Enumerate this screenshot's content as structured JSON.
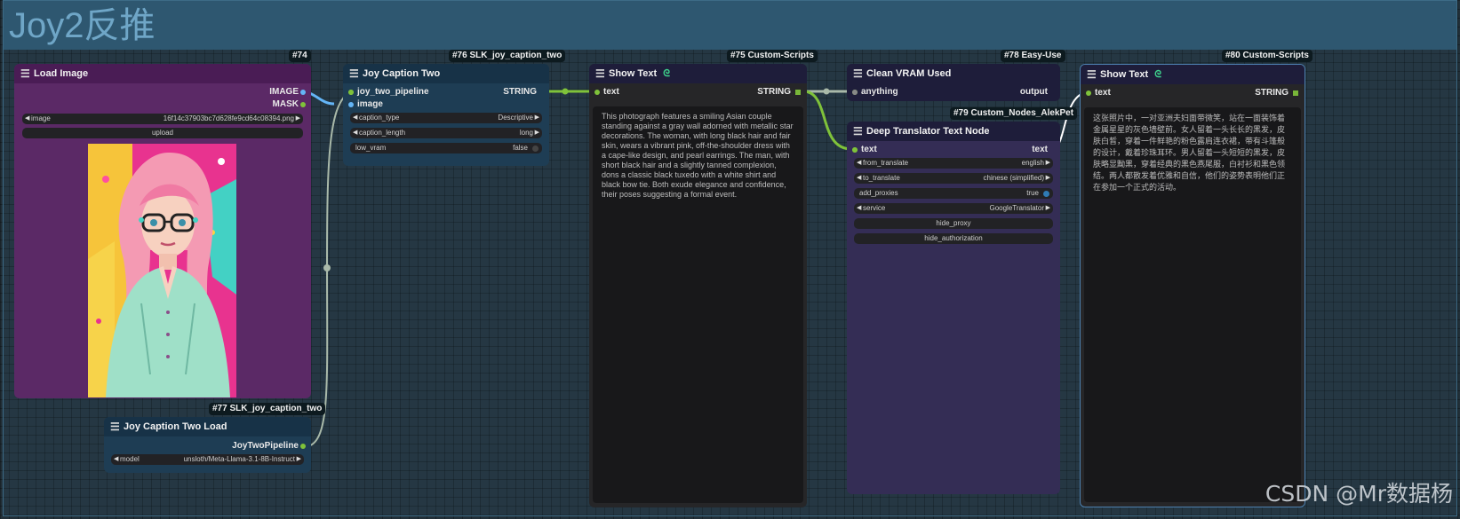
{
  "group": {
    "title": "Joy2反推"
  },
  "nodes": {
    "load_image": {
      "badge": "#74",
      "title": "Load Image",
      "outputs": [
        "IMAGE",
        "MASK"
      ],
      "image_widget": {
        "label": "image",
        "value": "16f14c37903bc7d628fe9cd64c08394.png"
      },
      "upload_label": "upload"
    },
    "caption": {
      "badge": "#76 SLK_joy_caption_two",
      "title": "Joy Caption Two",
      "inputs": [
        "joy_two_pipeline",
        "image"
      ],
      "output": "STRING",
      "widgets": [
        {
          "label": "caption_type",
          "value": "Descriptive"
        },
        {
          "label": "caption_length",
          "value": "long"
        },
        {
          "label": "low_vram",
          "value": "false"
        }
      ]
    },
    "show_text_1": {
      "badge": "#75 Custom-Scripts",
      "title": "Show Text",
      "input": "text",
      "output": "STRING",
      "text": "This photograph features a smiling Asian couple standing against a gray wall adorned with metallic star decorations. The woman, with long black hair and fair skin, wears a vibrant pink, off-the-shoulder dress with a cape-like design, and pearl earrings. The man, with short black hair and a slightly tanned complexion, dons a classic black tuxedo with a white shirt and black bow tie. Both exude elegance and confidence, their poses suggesting a formal event."
    },
    "vram": {
      "badge": "#78 Easy-Use",
      "title": "Clean VRAM Used",
      "input": "anything",
      "output": "output"
    },
    "translator": {
      "badge": "#79 Custom_Nodes_AlekPet",
      "title": "Deep Translator Text Node",
      "input": "text",
      "output": "text",
      "widgets": [
        {
          "label": "from_translate",
          "value": "english"
        },
        {
          "label": "to_translate",
          "value": "chinese (simplified)"
        },
        {
          "label": "add_proxies",
          "value": "true"
        },
        {
          "label": "service",
          "value": "GoogleTranslator"
        }
      ],
      "buttons": [
        "hide_proxy",
        "hide_authorization"
      ]
    },
    "show_text_2": {
      "badge": "#80 Custom-Scripts",
      "title": "Show Text",
      "input": "text",
      "output": "STRING",
      "text": "这张照片中，一对亚洲夫妇面带微笑，站在一面装饰着金属星星的灰色墙壁前。女人留着一头长长的黑发，皮肤白皙，穿着一件鲜艳的粉色露肩连衣裙，带有斗篷般的设计，戴着珍珠耳环。男人留着一头短短的黑发，皮肤略显黝黑，穿着经典的黑色燕尾服，白衬衫和黑色领结。两人都散发着优雅和自信，他们的姿势表明他们正在参加一个正式的活动。"
    },
    "loader": {
      "badge": "#77 SLK_joy_caption_two",
      "title": "Joy Caption Two Load",
      "output": "JoyTwoPipeline",
      "widget": {
        "label": "model",
        "value": "unsloth/Meta-Llama-3.1-8B-Instruct"
      }
    }
  },
  "watermark": "CSDN @Mr数据杨",
  "colors": {
    "string_wire": "#7fc23a",
    "image_wire": "#64b5f6",
    "generic_wire": "#a9b9a9"
  }
}
